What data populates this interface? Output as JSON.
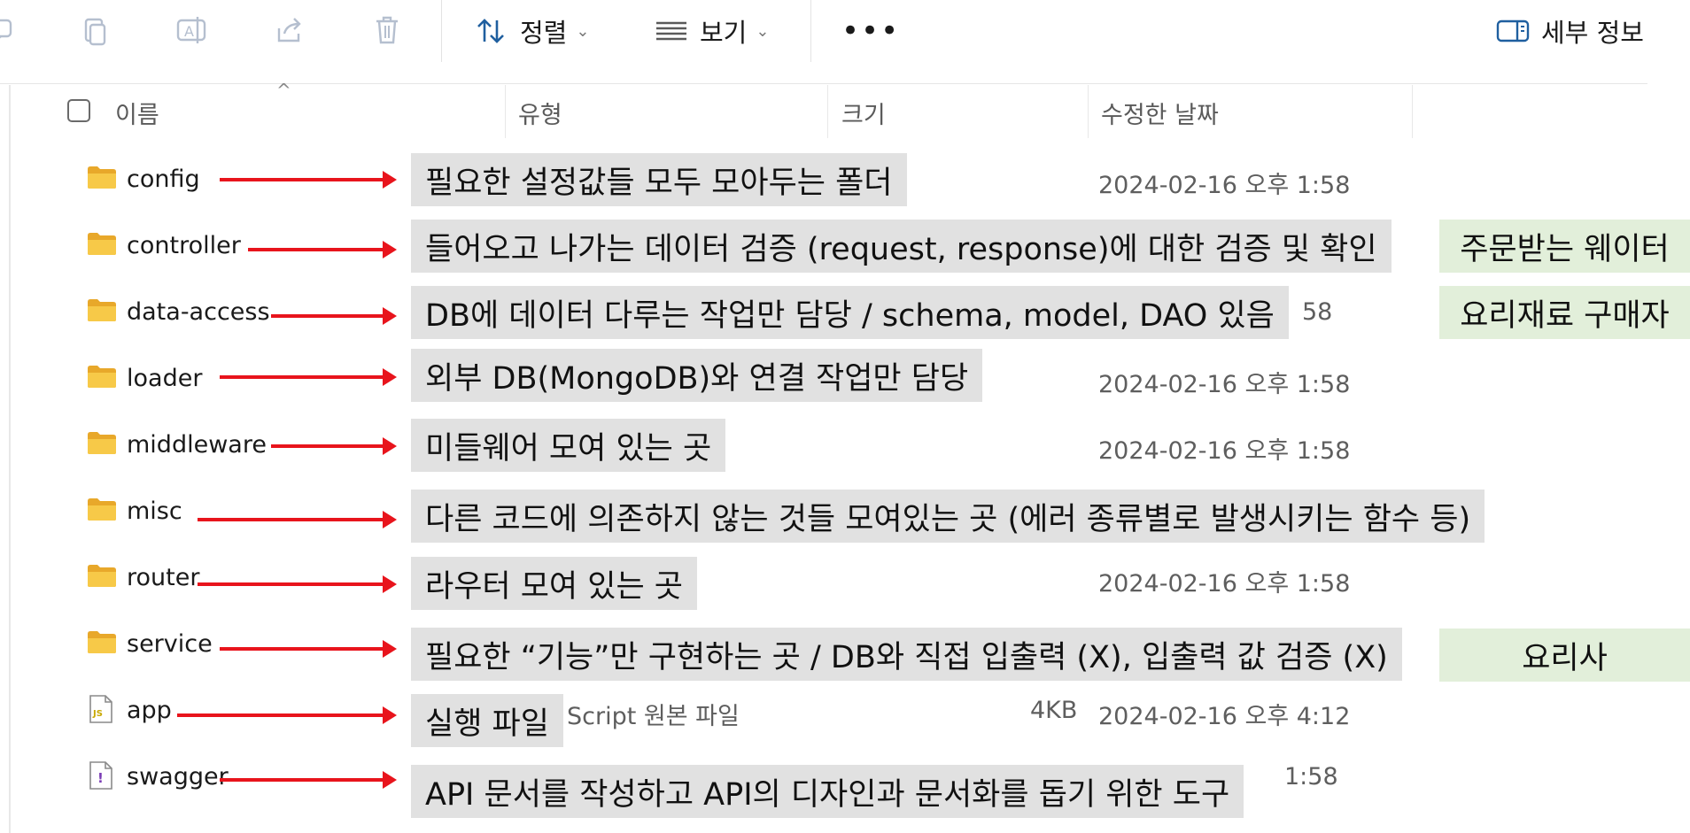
{
  "toolbar": {
    "sort_label": "정렬",
    "view_label": "보기",
    "more_label": "•••",
    "details_label": "세부 정보"
  },
  "columns": {
    "name": "이름",
    "type": "유형",
    "size": "크기",
    "modified": "수정한 날짜"
  },
  "files": [
    {
      "name": "config",
      "icon": "folder-icon",
      "date": "2024-02-16 오후 1:58",
      "type": "",
      "size": "",
      "note": "필요한 설정값들 모두 모아두는 폴더",
      "role": ""
    },
    {
      "name": "controller",
      "icon": "folder-icon",
      "date": "",
      "type": "",
      "size": "",
      "note": "들어오고 나가는 데이터 검증 (request, response)에 대한 검증 및 확인",
      "role": "주문받는 웨이터"
    },
    {
      "name": "data-access",
      "icon": "folder-icon",
      "date": "58",
      "type": "",
      "size": "",
      "note": "DB에 데이터 다루는 작업만 담당 / schema, model, DAO 있음",
      "role": "요리재료 구매자"
    },
    {
      "name": "loader",
      "icon": "folder-icon",
      "date": "2024-02-16 오후 1:58",
      "type": "",
      "size": "",
      "note": "외부 DB(MongoDB)와 연결 작업만 담당",
      "role": ""
    },
    {
      "name": "middleware",
      "icon": "folder-icon",
      "date": "2024-02-16 오후 1:58",
      "type": "",
      "size": "",
      "note": "미들웨어 모여 있는 곳",
      "role": ""
    },
    {
      "name": "misc",
      "icon": "folder-icon",
      "date": "",
      "type": "",
      "size": "",
      "note": "다른 코드에 의존하지 않는 것들 모여있는 곳 (에러 종류별로 발생시키는 함수 등)",
      "role": ""
    },
    {
      "name": "router",
      "icon": "folder-icon",
      "date": "2024-02-16 오후 1:58",
      "type": "",
      "size": "",
      "note": "라우터 모여 있는 곳",
      "role": ""
    },
    {
      "name": "service",
      "icon": "folder-icon",
      "date": "",
      "type": "",
      "size": "",
      "note": "필요한 “기능”만 구현하는 곳 / DB와 직접 입출력 (X), 입출력 값 검증 (X)",
      "role": "요리사"
    },
    {
      "name": "app",
      "icon": "js-file-icon",
      "date": "2024-02-16 오후 4:12",
      "type": "Script 원본 파일",
      "size": "4KB",
      "note": "실행 파일",
      "role": ""
    },
    {
      "name": "swagger",
      "icon": "yaml-file-icon",
      "date": "1:58",
      "type": "",
      "size": "",
      "note": "API 문서를 작성하고 API의 디자인과 문서화를 돕기 위한 도구",
      "role": ""
    }
  ],
  "colors": {
    "arrow": "#e8141c",
    "note_bg": "#e1e1e1",
    "role_bg": "#e2efda",
    "folder": "#f5c341"
  }
}
